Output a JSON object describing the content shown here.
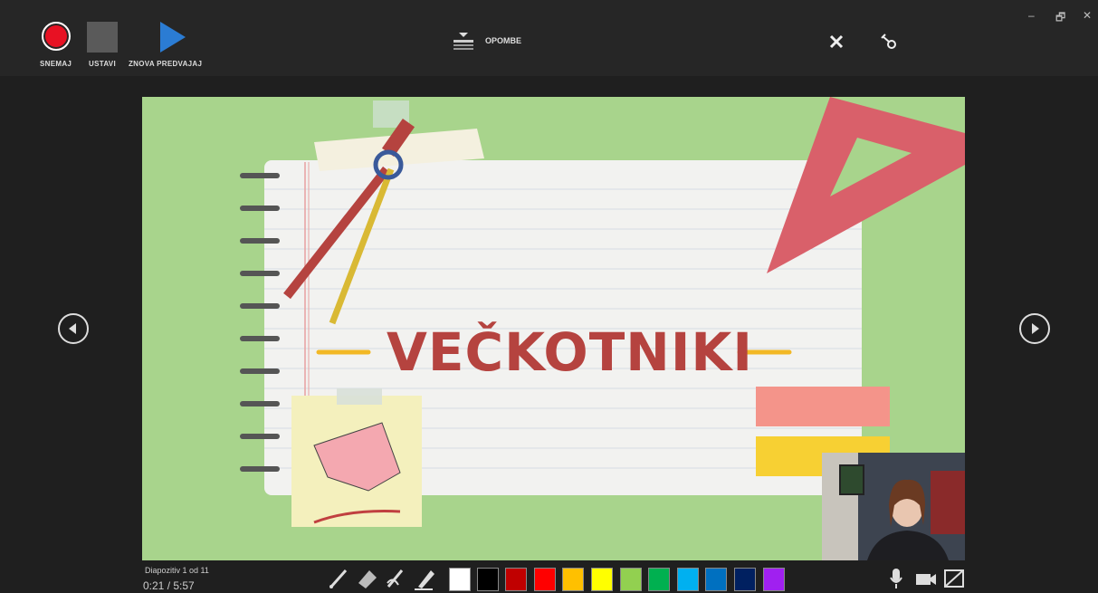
{
  "toolbar": {
    "record_label": "SNEMAJ",
    "stop_label": "USTAVI",
    "replay_label": "ZNOVA PREDVAJAJ",
    "notes_label": "OPOMBE"
  },
  "window_controls": {
    "minimize": "–",
    "restore": "🗗",
    "close": "✕"
  },
  "slide": {
    "title": "VEČKOTNIKI",
    "bg_color": "#a8d48c",
    "title_color": "#b5433f"
  },
  "status": {
    "slide_info": "Diapozitiv 1 od 11",
    "time": "0:21 / 5:57"
  },
  "palette": [
    "#ffffff",
    "#000000",
    "#c00000",
    "#ff0000",
    "#ffc000",
    "#ffff00",
    "#92d050",
    "#00b050",
    "#00b0f0",
    "#0070c0",
    "#002060",
    "#a020f0"
  ],
  "icons": {
    "record": "record-icon",
    "stop": "stop-icon",
    "replay": "play-icon",
    "notes": "notes-icon",
    "close": "close-icon",
    "pin": "pin-icon",
    "prev": "previous-slide-icon",
    "next": "next-slide-icon",
    "mic": "microphone-icon",
    "camera": "camera-icon",
    "camera_preview": "camera-preview-off-icon"
  }
}
